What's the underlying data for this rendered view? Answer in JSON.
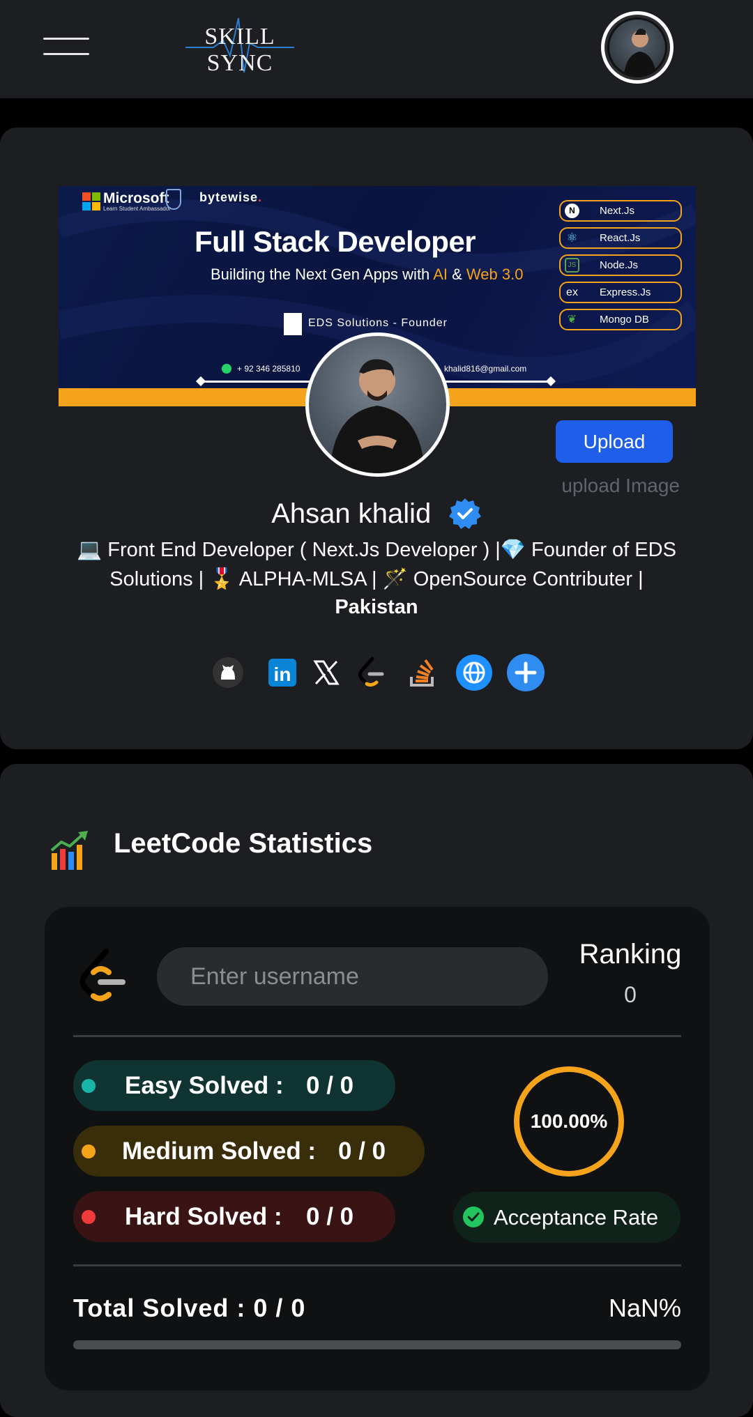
{
  "header": {
    "logo_text": "SKILL SYNC",
    "menu_icon": "hamburger-icon",
    "avatar_alt": "profile-avatar"
  },
  "banner": {
    "ms_text": "Microsoft",
    "ms_sub": "Learn Student Ambassador",
    "bytewise": "bytewise",
    "title": "Full Stack Developer",
    "subtitle_pre": "Building the Next Gen Apps with ",
    "subtitle_ai": "AI",
    "subtitle_mid": " & ",
    "subtitle_web": "Web 3.0",
    "eds": "EDS Solutions - Founder",
    "phone": "+ 92 346 285810",
    "email": "khalid816@gmail.com",
    "techs": [
      "Next.Js",
      "React.Js",
      "Node.Js",
      "Express.Js",
      "Mongo DB"
    ]
  },
  "profile": {
    "upload_label": "Upload",
    "upload_hint": "upload Image",
    "name": "Ahsan khalid",
    "bio": "💻 Front End Developer ( Next.Js Developer ) |💎 Founder of EDS Solutions | 🎖️ ALPHA-MLSA | 🪄 OpenSource Contributer |",
    "country": "Pakistan",
    "socials": [
      "github-icon",
      "linkedin-icon",
      "x-icon",
      "leetcode-icon",
      "stackoverflow-icon",
      "website-icon",
      "add-link-icon"
    ]
  },
  "stats": {
    "title": "LeetCode Statistics",
    "username_placeholder": "Enter username",
    "ranking_label": "Ranking",
    "ranking_value": "0",
    "easy_label": "Easy Solved :",
    "easy_value": "0 / 0",
    "medium_label": "Medium Solved :",
    "medium_value": "0 / 0",
    "hard_label": "Hard Solved :",
    "hard_value": "0 / 0",
    "acceptance_percent": "100.00%",
    "acceptance_label": "Acceptance Rate",
    "total_label": "Total Solved : 0 / 0",
    "total_percent": "NaN%",
    "total_progress_fraction": 0
  },
  "colors": {
    "easy": "#19b5a6",
    "medium": "#f5a31a",
    "hard": "#ef3b3b",
    "accent": "#1f5ee8",
    "card": "#1c1e21"
  }
}
